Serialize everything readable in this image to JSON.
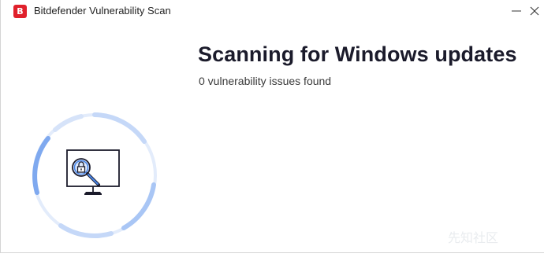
{
  "window": {
    "title": "Bitdefender Vulnerability Scan",
    "app_icon_letter": "B",
    "brand_color": "#e0202b"
  },
  "controls": {
    "minimize_icon": "minimize-icon",
    "close_icon": "close-icon"
  },
  "scan": {
    "heading": "Scanning for Windows updates",
    "issues_text": "0 vulnerability issues found",
    "ring_color": "#a9c6f5",
    "ring_accent_color": "#7fa9ef",
    "illustration_icon": "monitor-magnifier-lock-icon"
  },
  "watermark": {
    "text": "先知社区"
  }
}
